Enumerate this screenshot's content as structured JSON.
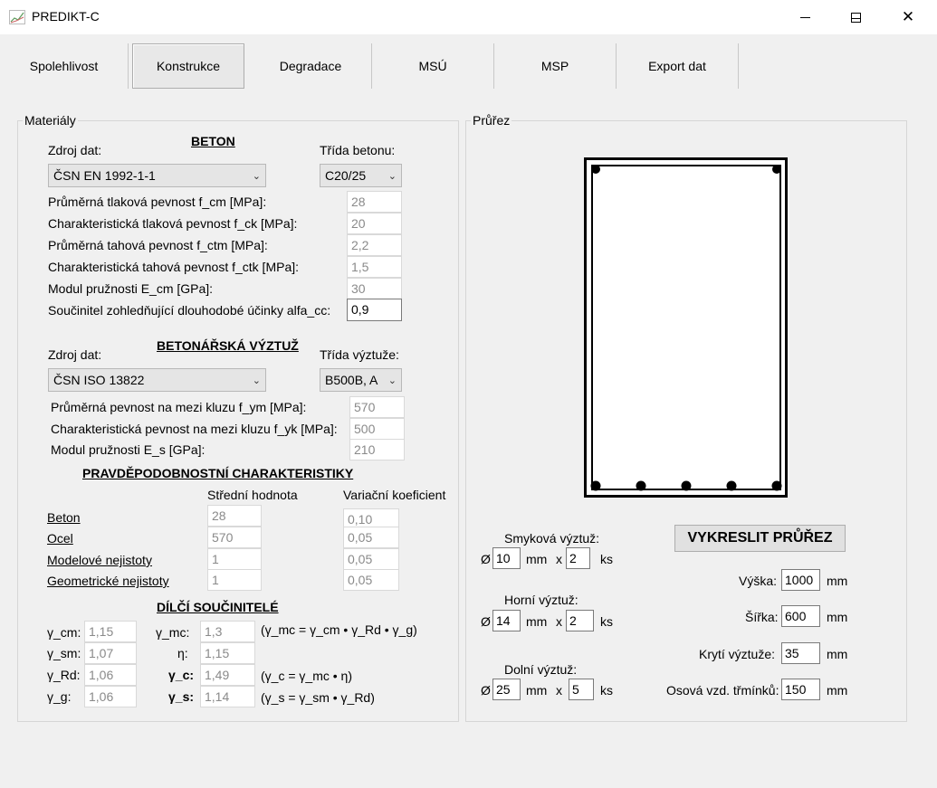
{
  "window": {
    "title": "PREDIKT-C",
    "minimize": "—",
    "maximize": "☐",
    "close": "✕"
  },
  "tabs": [
    {
      "label": "Spolehlivost"
    },
    {
      "label": "Konstrukce"
    },
    {
      "label": "Degradace"
    },
    {
      "label": "MSÚ"
    },
    {
      "label": "MSP"
    },
    {
      "label": "Export dat"
    }
  ],
  "materials": {
    "group_title": "Materiály",
    "beton": {
      "heading": "BETON",
      "source_label": "Zdroj dat:",
      "source_value": "ČSN EN 1992-1-1",
      "class_label": "Třída betonu:",
      "class_value": "C20/25",
      "props": [
        {
          "label": "Průměrná tlaková pevnost f_cm [MPa]:",
          "value": "28"
        },
        {
          "label": "Charakteristická tlaková pevnost f_ck [MPa]:",
          "value": "20"
        },
        {
          "label": "Průměrná tahová pevnost f_ctm [MPa]:",
          "value": "2,2"
        },
        {
          "label": "Charakteristická tahová pevnost f_ctk [MPa]:",
          "value": "1,5"
        },
        {
          "label": "Modul pružnosti E_cm [GPa]:",
          "value": "30"
        },
        {
          "label": "Součinitel zohledňující dlouhodobé účinky alfa_cc:",
          "value": "0,9"
        }
      ]
    },
    "steel": {
      "heading": "BETONÁŘSKÁ VÝZTUŽ",
      "source_label": "Zdroj dat:",
      "source_value": "ČSN ISO 13822",
      "class_label": "Třída výztuže:",
      "class_value": "B500B, A",
      "props": [
        {
          "label": "Průměrná pevnost na mezi kluzu f_ym [MPa]:",
          "value": "570"
        },
        {
          "label": "Charakteristická pevnost na mezi kluzu f_yk  [MPa]:",
          "value": "500"
        },
        {
          "label": "Modul pružnosti E_s [GPa]:",
          "value": "210"
        }
      ]
    },
    "prob": {
      "heading": "PRAVDĚPODOBNOSTNÍ CHARAKTERISTIKY",
      "col_mean": "Střední hodnota",
      "col_cov": "Variační koeficient",
      "rows": [
        {
          "label": "Beton",
          "mean": "28",
          "cov": "0,10"
        },
        {
          "label": "Ocel",
          "mean": "570",
          "cov": "0,05"
        },
        {
          "label": "Modelové nejistoty",
          "mean": "1",
          "cov": "0,05"
        },
        {
          "label": "Geometrické nejistoty",
          "mean": "1",
          "cov": "0,05"
        }
      ]
    },
    "factors": {
      "heading": "DÍLČÍ SOUČINITELÉ",
      "g_cm_label": "γ_cm:",
      "g_cm": "1,15",
      "g_sm_label": "γ_sm:",
      "g_sm": "1,07",
      "g_rd_label": "γ_Rd:",
      "g_rd": "1,06",
      "g_g_label": "γ_g:",
      "g_g": "1,06",
      "g_mc_label": "γ_mc:",
      "g_mc": "1,3",
      "eta_label": "η:",
      "eta": "1,15",
      "g_c_label": "γ_c:",
      "g_c": "1,49",
      "g_s_label": "γ_s:",
      "g_s": "1,14",
      "eq_mc": "(γ_mc = γ_cm • γ_Rd • γ_g)",
      "eq_c": "(γ_c = γ_mc • η)",
      "eq_s": "(γ_s = γ_sm • γ_Rd)"
    }
  },
  "section": {
    "group_title": "Průřez",
    "draw_button": "VYKRESLIT PRŮŘEZ",
    "shear": {
      "label": "Smyková výztuž:",
      "diam_prefix": "Ø",
      "diameter": "10",
      "unit": "mm",
      "x": "x",
      "count": "2",
      "ks": "ks"
    },
    "top": {
      "label": "Horní výztuž:",
      "diam_prefix": "Ø",
      "diameter": "14",
      "unit": "mm",
      "x": "x",
      "count": "2",
      "ks": "ks"
    },
    "bottom": {
      "label": "Dolní výztuž:",
      "diam_prefix": "Ø",
      "diameter": "25",
      "unit": "mm",
      "x": "x",
      "count": "5",
      "ks": "ks"
    },
    "height": {
      "label": "Výška:",
      "value": "1000",
      "unit": "mm"
    },
    "width": {
      "label": "Šířka:",
      "value": "600",
      "unit": "mm"
    },
    "cover": {
      "label": "Krytí výztuže:",
      "value": "35",
      "unit": "mm"
    },
    "spacing": {
      "label": "Osová vzd. třmínků:",
      "value": "150",
      "unit": "mm"
    }
  }
}
